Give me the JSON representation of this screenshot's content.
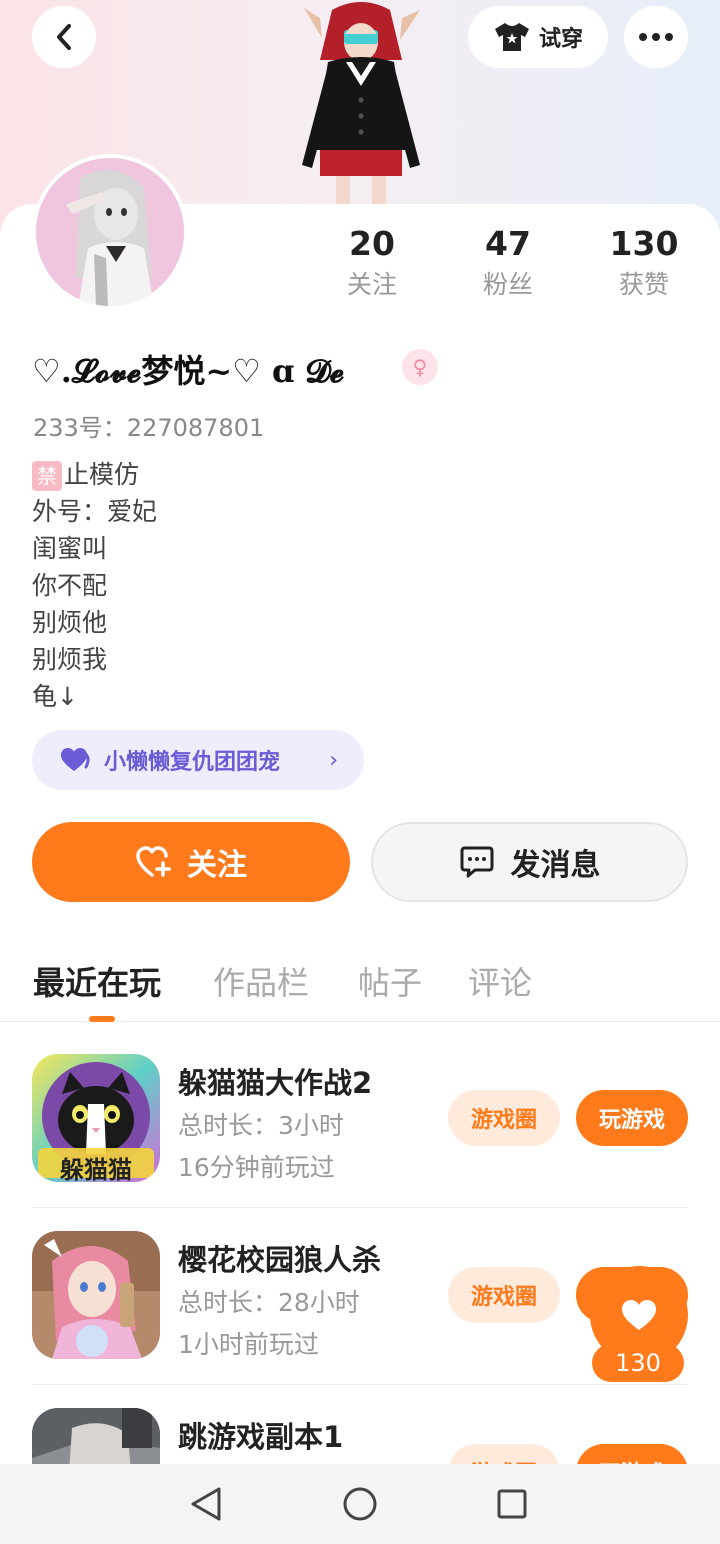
{
  "header": {
    "try_on_label": "试穿",
    "back_icon": "chevron-left-icon",
    "more_icon": "more-dots-icon",
    "try_on_icon": "tshirt-icon"
  },
  "profile": {
    "nickname": "♡.𝓛𝓸𝓿𝓮梦悦~♡ ɑ 𝓓𝓮",
    "uid_label": "233号：227087801",
    "gender": "female",
    "stats": [
      {
        "value": "20",
        "label": "关注"
      },
      {
        "value": "47",
        "label": "粉丝"
      },
      {
        "value": "130",
        "label": "获赞"
      }
    ],
    "bio_badge": "禁",
    "bio_lines": [
      "止模仿",
      "外号：爱妃",
      "闺蜜叫",
      "你不配",
      "别烦他",
      "别烦我",
      "龟↓"
    ],
    "group_label": "小懒懒复仇团团宠"
  },
  "actions": {
    "follow_label": "关注",
    "message_label": "发消息"
  },
  "tabs": [
    {
      "label": "最近在玩",
      "active": true
    },
    {
      "label": "作品栏",
      "active": false
    },
    {
      "label": "帖子",
      "active": false
    },
    {
      "label": "评论",
      "active": false
    }
  ],
  "games": [
    {
      "name": "躲猫猫大作战2",
      "duration": "总时长：3小时",
      "last_played": "16分钟前玩过",
      "icon_text": "躲猫猫",
      "circle_label": "游戏圈",
      "play_label": "玩游戏"
    },
    {
      "name": "樱花校园狼人杀",
      "duration": "总时长：28小时",
      "last_played": "1小时前玩过",
      "circle_label": "游戏圈",
      "play_label": "玩游戏"
    },
    {
      "name": "跳游戏副本1",
      "duration": "",
      "last_played": "",
      "circle_label": "游戏圈",
      "play_label": "玩游戏"
    }
  ],
  "like_fab": {
    "count": "130"
  },
  "colors": {
    "accent": "#ff7a1a",
    "group_purple": "#6a5bd6"
  }
}
